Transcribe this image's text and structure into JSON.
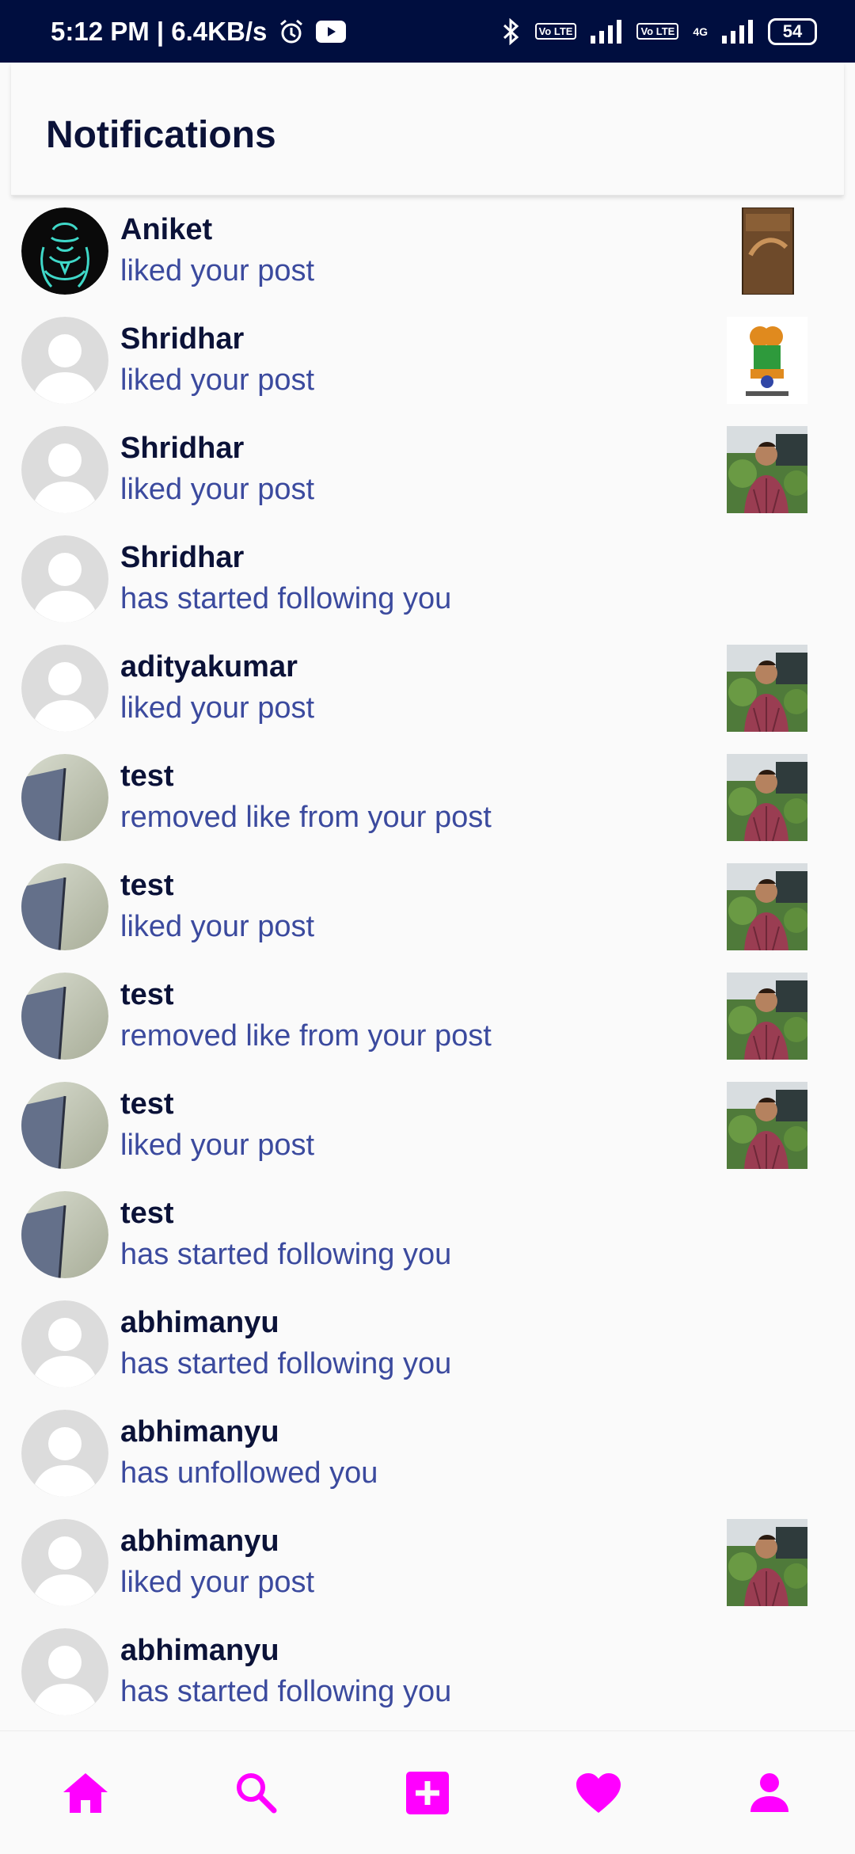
{
  "status_bar": {
    "time_speed": "5:12 PM | 6.4KB/s",
    "battery": "54",
    "sim1": "Vo LTE",
    "sim2": "Vo LTE",
    "network": "4G"
  },
  "header": {
    "title": "Notifications"
  },
  "notifications": [
    {
      "user": "Aniket",
      "action": "liked your post",
      "avatar": "aniket",
      "thumb": "book"
    },
    {
      "user": "Shridhar",
      "action": "liked your post",
      "avatar": "default",
      "thumb": "emblem"
    },
    {
      "user": "Shridhar",
      "action": "liked your post",
      "avatar": "default",
      "thumb": "person"
    },
    {
      "user": "Shridhar",
      "action": "has started following you",
      "avatar": "default",
      "thumb": ""
    },
    {
      "user": "adityakumar",
      "action": "liked your post",
      "avatar": "default",
      "thumb": "person"
    },
    {
      "user": "test",
      "action": "removed like from your post",
      "avatar": "photo",
      "thumb": "person"
    },
    {
      "user": "test",
      "action": "liked your post",
      "avatar": "photo",
      "thumb": "person"
    },
    {
      "user": "test",
      "action": "removed like from your post",
      "avatar": "photo",
      "thumb": "person"
    },
    {
      "user": "test",
      "action": "liked your post",
      "avatar": "photo",
      "thumb": "person"
    },
    {
      "user": "test",
      "action": "has started following you",
      "avatar": "photo",
      "thumb": ""
    },
    {
      "user": "abhimanyu",
      "action": "has started following you",
      "avatar": "default",
      "thumb": ""
    },
    {
      "user": "abhimanyu",
      "action": "has unfollowed you",
      "avatar": "default",
      "thumb": ""
    },
    {
      "user": "abhimanyu",
      "action": "liked your post",
      "avatar": "default",
      "thumb": "person"
    },
    {
      "user": "abhimanyu",
      "action": "has started following you",
      "avatar": "default",
      "thumb": ""
    }
  ],
  "bottom_nav": {
    "accent_color": "#ff00ff",
    "items": [
      "home-icon",
      "search-icon",
      "add-post-icon",
      "heart-icon",
      "profile-icon"
    ]
  }
}
